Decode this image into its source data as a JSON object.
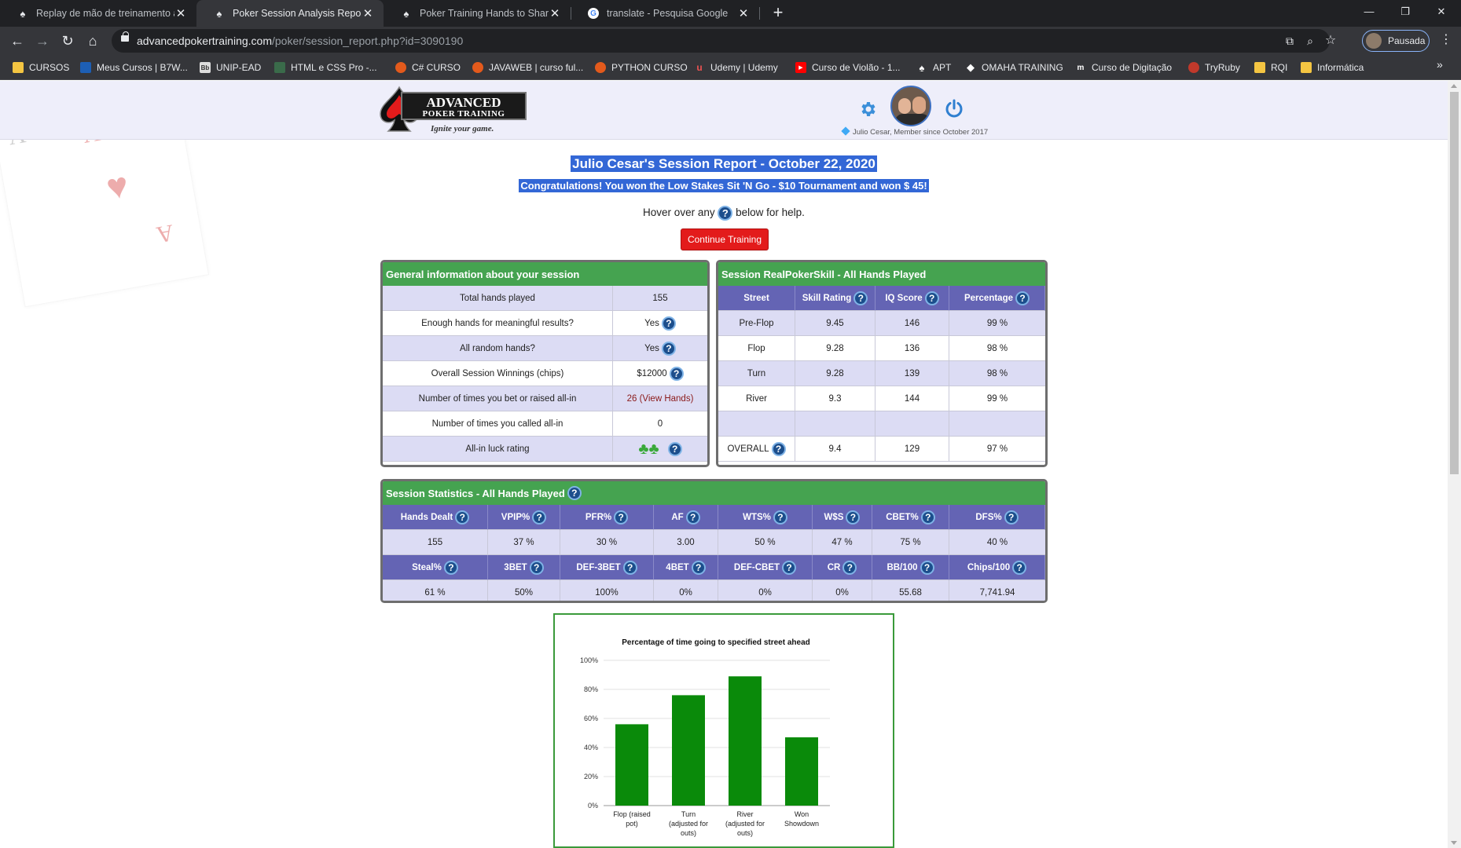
{
  "browser": {
    "tabs": [
      {
        "title": "Replay de mão de treinamento a",
        "active": false
      },
      {
        "title": "Poker Session Analysis Report",
        "active": true
      },
      {
        "title": "Poker Training Hands to Share",
        "active": false
      },
      {
        "title": "translate - Pesquisa Google",
        "active": false
      }
    ],
    "url_host": "advancedpokertraining.com",
    "url_path": "/poker/session_report.php?id=3090190",
    "profile_label": "Pausada",
    "bookmarks": [
      "CURSOS",
      "Meus Cursos | B7W...",
      "UNIP-EAD",
      "HTML e CSS Pro -...",
      "C# CURSO",
      "JAVAWEB | curso ful...",
      "PYTHON CURSO",
      "Udemy | Udemy",
      "Curso de Violão - 1...",
      "APT",
      "OMAHA TRAINING",
      "Curso de Digitação",
      "TryRuby",
      "RQI",
      "Informática"
    ]
  },
  "header": {
    "logo_line1": "ADVANCED",
    "logo_line2": "POKER TRAINING",
    "logo_tagline": "Ignite your game.",
    "member_text": "Julio Cesar, Member since October 2017"
  },
  "report": {
    "title": "Julio Cesar's Session Report - October 22, 2020",
    "congrats": "Congratulations! You won the Low Stakes Sit 'N Go - $10 Tournament and won $ 45!",
    "hover_before": "Hover over any",
    "hover_after": "below for help.",
    "continue_label": "Continue Training",
    "help_glyph": "?"
  },
  "general_info": {
    "title": "General information about your session",
    "rows": [
      {
        "label": "Total hands played",
        "value": "155"
      },
      {
        "label": "Enough hands for meaningful results?",
        "value": "Yes"
      },
      {
        "label": "All random hands?",
        "value": "Yes"
      },
      {
        "label": "Overall Session Winnings (chips)",
        "value": "$12000"
      },
      {
        "label": "Number of times you bet or raised all-in",
        "value": "26 (View Hands)"
      },
      {
        "label": "Number of times you called all-in",
        "value": "0"
      },
      {
        "label": "All-in luck rating",
        "value": ""
      }
    ]
  },
  "skill": {
    "title": "Session RealPokerSkill - All Hands Played",
    "headers": [
      "Street",
      "Skill Rating",
      "IQ Score",
      "Percentage"
    ],
    "rows": [
      [
        "Pre-Flop",
        "9.45",
        "146",
        "99 %"
      ],
      [
        "Flop",
        "9.28",
        "136",
        "98 %"
      ],
      [
        "Turn",
        "9.28",
        "139",
        "98 %"
      ],
      [
        "River",
        "9.3",
        "144",
        "99 %"
      ],
      [
        "",
        "",
        "",
        ""
      ],
      [
        "OVERALL",
        "9.4",
        "129",
        "97 %"
      ]
    ]
  },
  "stats": {
    "title": "Session Statistics - All Hands Played",
    "headers1": [
      "Hands Dealt",
      "VPIP%",
      "PFR%",
      "AF",
      "WTS%",
      "W$S",
      "CBET%",
      "DFS%"
    ],
    "values1": [
      "155",
      "37 %",
      "30 %",
      "3.00",
      "50 %",
      "47 %",
      "75 %",
      "40 %"
    ],
    "headers2": [
      "Steal%",
      "3BET",
      "DEF-3BET",
      "4BET",
      "DEF-CBET",
      "CR",
      "BB/100",
      "Chips/100"
    ],
    "values2": [
      "61 %",
      "50%",
      "100%",
      "0%",
      "0%",
      "0%",
      "55.68",
      "7,741.94"
    ]
  },
  "chart_data": {
    "type": "bar",
    "title": "Percentage of time going to specified street ahead",
    "categories": [
      "Flop (raised pot)",
      "Turn (adjusted for outs)",
      "River (adjusted for outs)",
      "Won Showdown"
    ],
    "category_lines": [
      [
        "Flop (raised",
        "pot)"
      ],
      [
        "Turn",
        "(adjusted for",
        "outs)"
      ],
      [
        "River",
        "(adjusted for",
        "outs)"
      ],
      [
        "Won",
        "Showdown"
      ]
    ],
    "values": [
      56,
      76,
      89,
      47
    ],
    "ylim": [
      0,
      100
    ],
    "yticks": [
      "0%",
      "20%",
      "40%",
      "60%",
      "80%",
      "100%"
    ],
    "color": "#0a8a0a",
    "grid": true
  }
}
